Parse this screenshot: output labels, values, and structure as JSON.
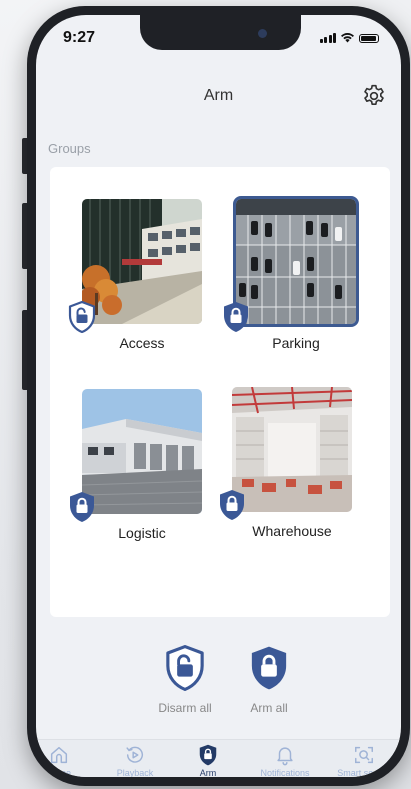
{
  "status_bar": {
    "time": "9:27"
  },
  "header": {
    "title": "Arm",
    "settings_icon": "gear-icon"
  },
  "groups": {
    "label": "Groups",
    "items": [
      {
        "name": "Access",
        "status": "disarmed",
        "selected": false
      },
      {
        "name": "Parking",
        "status": "armed",
        "selected": true
      },
      {
        "name": "Logistic",
        "status": "armed",
        "selected": false
      },
      {
        "name": "Wharehouse",
        "status": "armed",
        "selected": false
      }
    ]
  },
  "actions": {
    "disarm_all": "Disarm all",
    "arm_all": "Arm all"
  },
  "tabbar": {
    "items": [
      {
        "label": "Home",
        "icon": "home-icon"
      },
      {
        "label": "Playback",
        "icon": "playback-icon"
      },
      {
        "label": "Arm",
        "icon": "shield-icon",
        "active": true
      },
      {
        "label": "Notifications",
        "icon": "bell-icon"
      },
      {
        "label": "Smart search",
        "icon": "smart-search-icon"
      }
    ]
  },
  "colors": {
    "accent": "#3d5a91",
    "shield": "#3b5896",
    "background": "#eff1f5"
  }
}
